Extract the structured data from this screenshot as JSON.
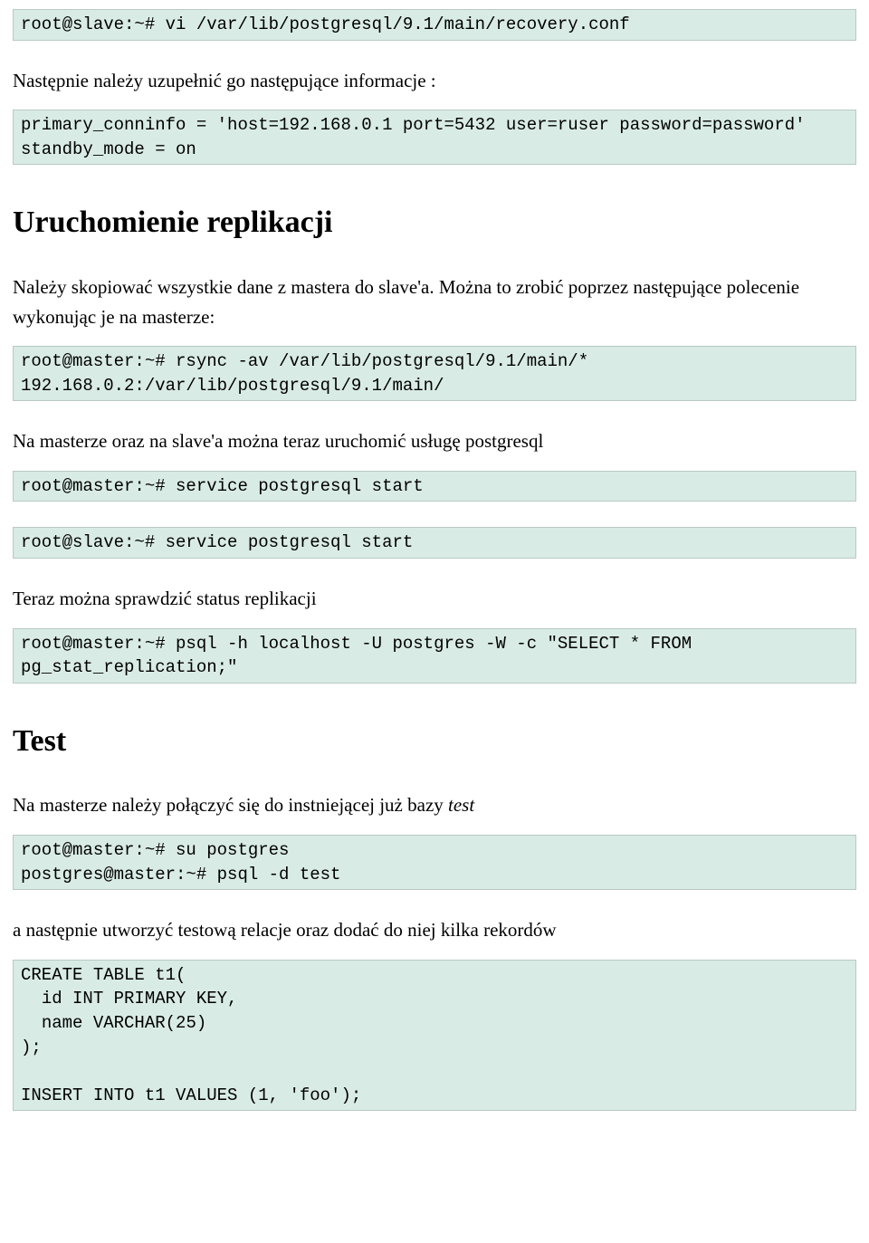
{
  "blocks": {
    "code1": "root@slave:~# vi /var/lib/postgresql/9.1/main/recovery.conf",
    "para1": "Następnie należy uzupełnić go następujące informacje :",
    "code2": "primary_conninfo = 'host=192.168.0.1 port=5432 user=ruser password=password'\nstandby_mode = on",
    "h1": "Uruchomienie replikacji",
    "para2": "Należy skopiować wszystkie dane z mastera do slave'a. Można to zrobić poprzez następujące polecenie wykonując je na masterze:",
    "code3": "root@master:~# rsync -av /var/lib/postgresql/9.1/main/* 192.168.0.2:/var/lib/postgresql/9.1/main/",
    "para3": "Na masterze oraz na slave'a można teraz uruchomić usługę postgresql",
    "code4": "root@master:~# service postgresql start",
    "code5": "root@slave:~# service postgresql start",
    "para4": "Teraz można sprawdzić status replikacji",
    "code6": "root@master:~# psql -h localhost -U postgres -W -c \"SELECT * FROM pg_stat_replication;\"",
    "h2": "Test",
    "para5_pre": "Na masterze należy połączyć się do instniejącej już bazy ",
    "para5_italic": "test",
    "code7": "root@master:~# su postgres\npostgres@master:~# psql -d test",
    "para6": "a następnie utworzyć testową relacje oraz dodać do niej kilka rekordów",
    "code8": "CREATE TABLE t1(\n  id INT PRIMARY KEY,\n  name VARCHAR(25)\n);\n\nINSERT INTO t1 VALUES (1, 'foo');"
  }
}
